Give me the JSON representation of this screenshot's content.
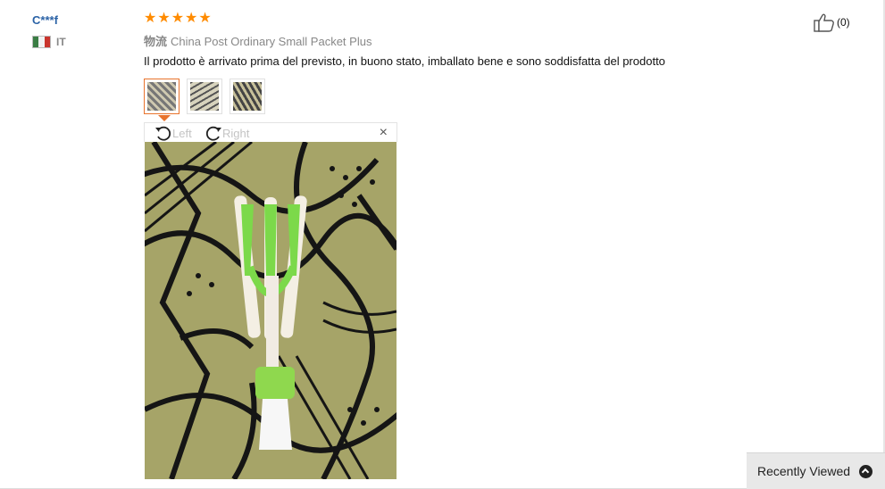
{
  "review": {
    "user_name": "C***f",
    "country_code": "IT",
    "rating": 5,
    "shipping_label": "物流",
    "shipping_method": "China Post Ordinary Small Packet Plus",
    "text": "Il prodotto è arrivato prima del previsto, in buono stato, imballato bene e sono soddisfatta del prodotto",
    "like_count": "(0)"
  },
  "viewer": {
    "rotate_left_label": "Left",
    "rotate_right_label": "Right",
    "close_glyph": "×",
    "thumbnail_count": 3,
    "selected_thumbnail": 1
  },
  "footer": {
    "recently_viewed_label": "Recently Viewed"
  },
  "icons": {
    "star": "star-icon",
    "thumbs_up": "thumbs-up-icon",
    "rotate_left": "rotate-left-icon",
    "rotate_right": "rotate-right-icon",
    "close": "close-icon",
    "chevron_up": "chevron-up-icon"
  },
  "colors": {
    "star": "#ff8b00",
    "username": "#2a62a6",
    "selected_border": "#e8732c",
    "panel_bg": "#e8e8e8"
  }
}
